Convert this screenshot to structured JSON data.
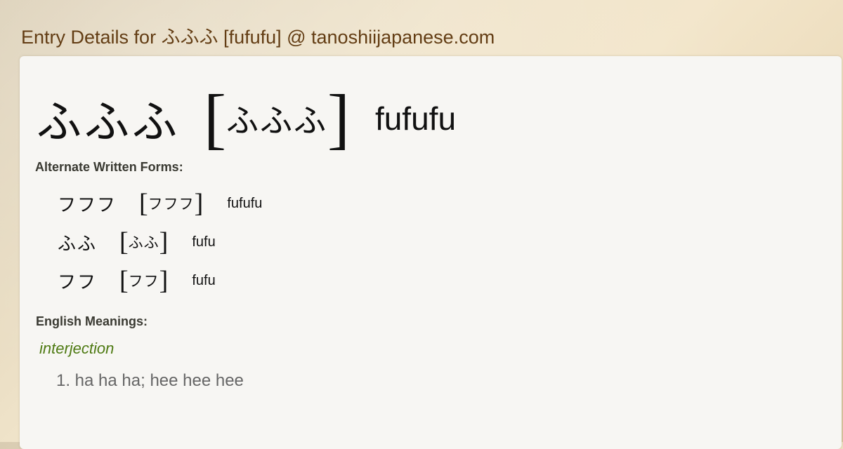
{
  "header": {
    "title": "Entry Details for ふふふ [fufufu] @ tanoshiijapanese.com"
  },
  "entry": {
    "kanji": "ふふふ",
    "bracket_open": "[",
    "reading": "ふふふ",
    "bracket_close": "]",
    "romaji": "fufufu"
  },
  "alternate_forms": {
    "label": "Alternate Written Forms:",
    "items": [
      {
        "kanji": "フフフ",
        "reading": "フフフ",
        "romaji": "fufufu"
      },
      {
        "kanji": "ふふ",
        "reading": "ふふ",
        "romaji": "fufu"
      },
      {
        "kanji": "フフ",
        "reading": "フフ",
        "romaji": "fufu"
      }
    ]
  },
  "meanings": {
    "label": "English Meanings:",
    "part_of_speech": "interjection",
    "items": [
      {
        "text": "1. ha ha ha; hee hee hee"
      }
    ]
  },
  "colors": {
    "title": "#633d14",
    "pos": "#4e7a12",
    "meaning": "#666666",
    "panel": "#f7f6f3"
  }
}
